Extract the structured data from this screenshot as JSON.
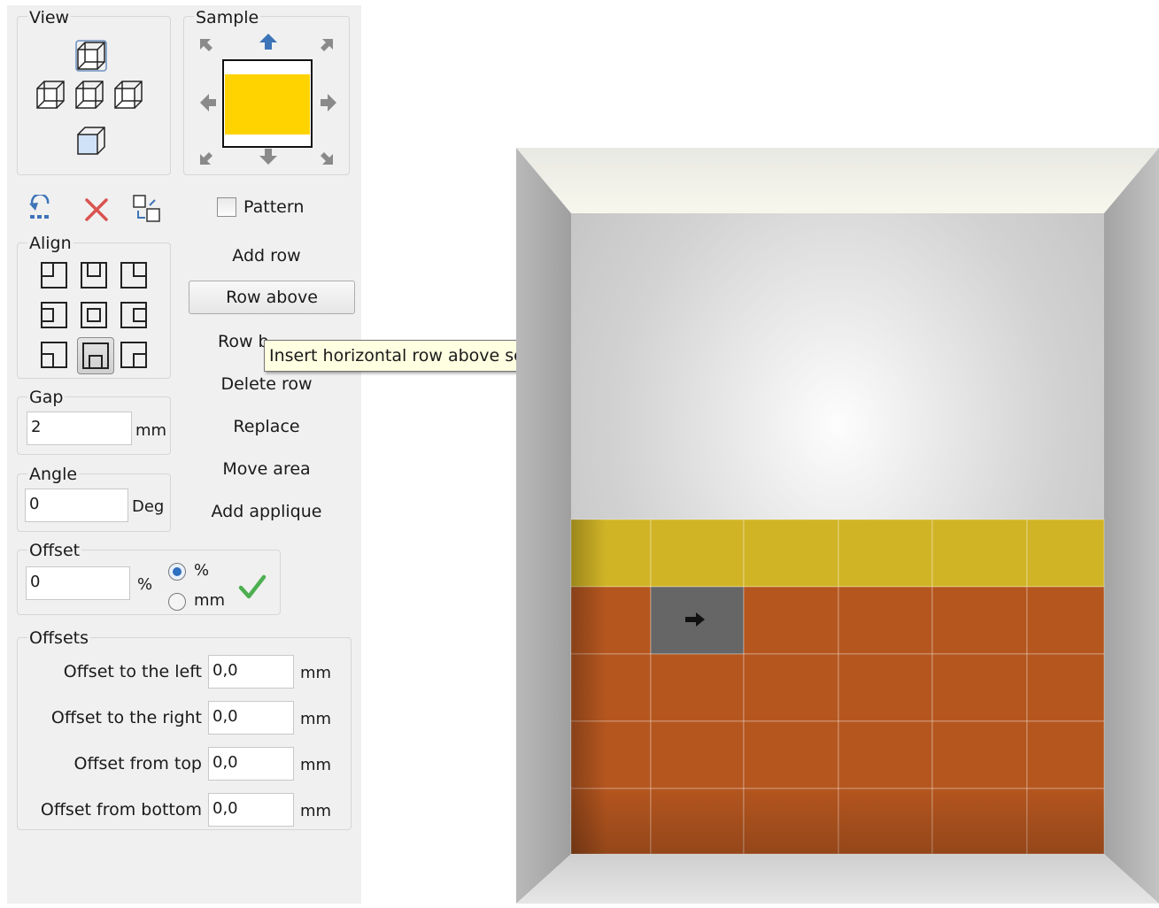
{
  "view": {
    "label": "View"
  },
  "sample": {
    "label": "Sample",
    "tile_color": "#ffd300"
  },
  "toolbar": {
    "pattern_label": "Pattern"
  },
  "align": {
    "label": "Align"
  },
  "menu": {
    "add_row": "Add row",
    "row_above": "Row above",
    "row_below": "Row b",
    "delete_row": "Delete row",
    "replace": "Replace",
    "move_area": "Move area",
    "add_applique": "Add applique"
  },
  "tooltip": {
    "text": "Insert horizontal row above selected tile"
  },
  "gap": {
    "label": "Gap",
    "value": "2",
    "unit": "mm"
  },
  "angle": {
    "label": "Angle",
    "value": "0",
    "unit": "Deg"
  },
  "offset": {
    "label": "Offset",
    "value": "0",
    "unit": "%",
    "radio_percent": "%",
    "radio_mm": "mm",
    "selected": "%"
  },
  "offsets": {
    "label": "Offsets",
    "rows": [
      {
        "label": "Offset to the left",
        "value": "0,0",
        "unit": "mm"
      },
      {
        "label": "Offset to the right",
        "value": "0,0",
        "unit": "mm"
      },
      {
        "label": "Offset from top",
        "value": "0,0",
        "unit": "mm"
      },
      {
        "label": "Offset from bottom",
        "value": "0,0",
        "unit": "mm"
      }
    ]
  },
  "colors": {
    "yellow_tile": "#d1b426",
    "orange_tile": "#b5561f",
    "selected_tile": "#666666",
    "wall": "#d4d4d4"
  }
}
